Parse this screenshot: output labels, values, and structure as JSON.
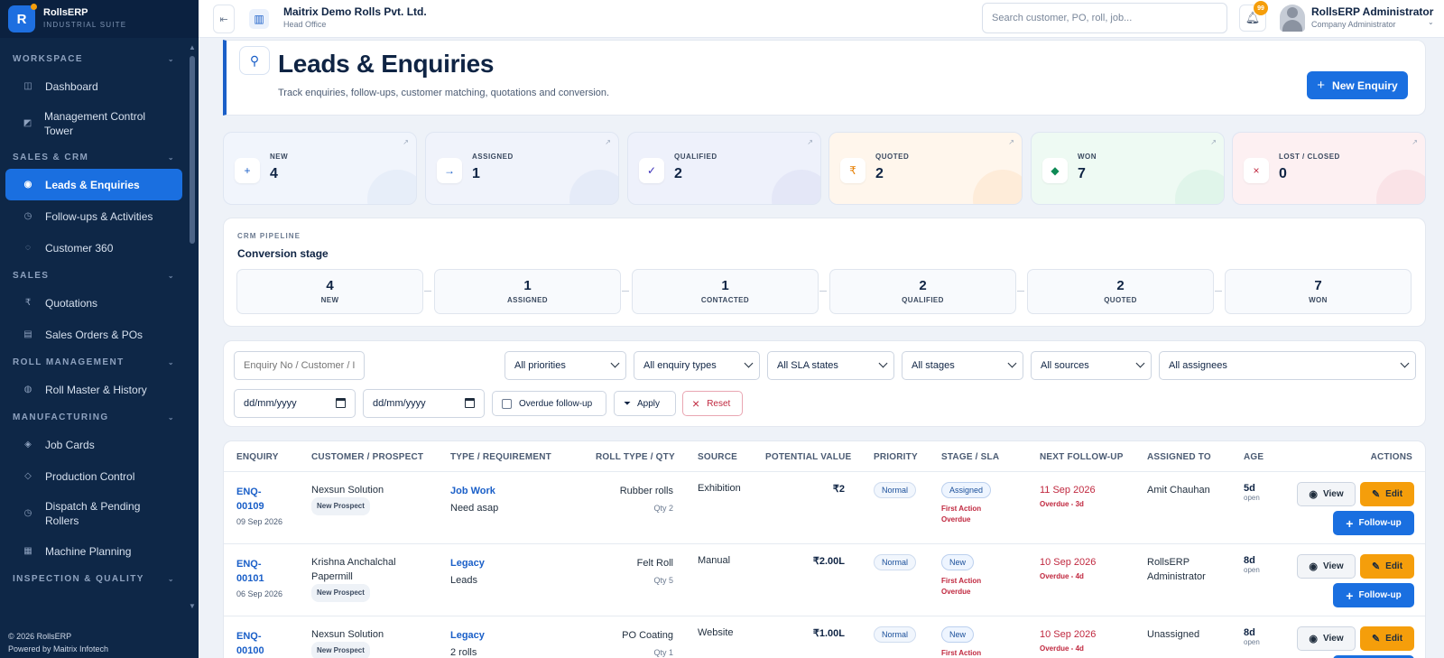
{
  "app": {
    "logo_letter": "R",
    "name": "RollsERP",
    "tagline": "INDUSTRIAL SUITE"
  },
  "colors": {
    "accent": "#1a6fe0",
    "sidebar": "#0e2747",
    "warning": "#f59e0b",
    "danger": "#c0283f"
  },
  "sidebar": {
    "sections": [
      {
        "title": "WORKSPACE",
        "items": [
          {
            "label": "Dashboard",
            "icon": "grid-icon"
          },
          {
            "label": "Management Control Tower",
            "icon": "tower-icon"
          }
        ]
      },
      {
        "title": "SALES & CRM",
        "items": [
          {
            "label": "Leads & Enquiries",
            "icon": "target-icon",
            "active": true
          },
          {
            "label": "Follow-ups & Activities",
            "icon": "clock-icon"
          },
          {
            "label": "Customer 360",
            "icon": "user-circle-icon"
          }
        ]
      },
      {
        "title": "SALES",
        "items": [
          {
            "label": "Quotations",
            "icon": "rupee-icon"
          },
          {
            "label": "Sales Orders & POs",
            "icon": "document-icon"
          }
        ]
      },
      {
        "title": "ROLL MANAGEMENT",
        "items": [
          {
            "label": "Roll Master & History",
            "icon": "roll-icon"
          }
        ]
      },
      {
        "title": "MANUFACTURING",
        "items": [
          {
            "label": "Job Cards",
            "icon": "diamond-icon"
          },
          {
            "label": "Production Control",
            "icon": "gear-icon"
          },
          {
            "label": "Dispatch & Pending Rollers",
            "icon": "truck-icon"
          },
          {
            "label": "Machine Planning",
            "icon": "calendar-icon"
          }
        ]
      },
      {
        "title": "INSPECTION & QUALITY",
        "items": []
      }
    ],
    "footer_copyright": "© 2026 RollsERP",
    "footer_powered": "Powered by Maitrix Infotech"
  },
  "topbar": {
    "company": "Maitrix Demo Rolls Pvt. Ltd.",
    "branch": "Head Office",
    "search_placeholder": "Search customer, PO, roll, job...",
    "notification_count": "99",
    "user_name": "RollsERP Administrator",
    "user_role": "Company Administrator"
  },
  "page": {
    "title": "Leads & Enquiries",
    "subtitle": "Track enquiries, follow-ups, customer matching, quotations and conversion.",
    "new_button": "New Enquiry"
  },
  "stats": [
    {
      "label": "NEW",
      "value": "4",
      "icon": "plus-icon",
      "glyph": "+",
      "color": "#1a5fc8",
      "bg": "#f1f5fc",
      "blob": "#dfe7f6"
    },
    {
      "label": "ASSIGNED",
      "value": "1",
      "icon": "arrow-right-icon",
      "glyph": "→",
      "color": "#1a5fc8",
      "bg": "#f0f3fb",
      "blob": "#dde3f5"
    },
    {
      "label": "QUALIFIED",
      "value": "2",
      "icon": "check-icon",
      "glyph": "✓",
      "color": "#3b2fb8",
      "bg": "#eef1fb",
      "blob": "#dcdff4"
    },
    {
      "label": "QUOTED",
      "value": "2",
      "icon": "rupee-icon",
      "glyph": "₹",
      "color": "#e67e00",
      "bg": "#fff6ec",
      "blob": "#fde4cb"
    },
    {
      "label": "WON",
      "value": "7",
      "icon": "diamond-icon",
      "glyph": "◆",
      "color": "#0e8a55",
      "bg": "#eefaf3",
      "blob": "#d5f0e1"
    },
    {
      "label": "LOST / CLOSED",
      "value": "0",
      "icon": "close-icon",
      "glyph": "×",
      "color": "#c0283f",
      "bg": "#fdf0f2",
      "blob": "#f8d9de"
    }
  ],
  "pipeline": {
    "section": "CRM PIPELINE",
    "title": "Conversion stage",
    "stages": [
      {
        "value": "4",
        "label": "NEW"
      },
      {
        "value": "1",
        "label": "ASSIGNED"
      },
      {
        "value": "1",
        "label": "CONTACTED"
      },
      {
        "value": "2",
        "label": "QUALIFIED"
      },
      {
        "value": "2",
        "label": "QUOTED"
      },
      {
        "value": "7",
        "label": "WON"
      }
    ]
  },
  "filters": {
    "search_placeholder": "Enquiry No / Customer / I",
    "selects": [
      "All priorities",
      "All enquiry types",
      "All SLA states",
      "All stages",
      "All sources",
      "All assignees"
    ],
    "date_placeholder": "dd/mm/yyyy",
    "overdue_label": "Overdue follow-up",
    "apply_label": "Apply",
    "reset_label": "Reset"
  },
  "table": {
    "columns": [
      "ENQUIRY",
      "CUSTOMER / PROSPECT",
      "TYPE / REQUIREMENT",
      "ROLL TYPE / QTY",
      "SOURCE",
      "POTENTIAL VALUE",
      "PRIORITY",
      "STAGE / SLA",
      "NEXT FOLLOW-UP",
      "ASSIGNED TO",
      "AGE",
      "ACTIONS"
    ],
    "view_label": "View",
    "edit_label": "Edit",
    "followup_label": "Follow-up",
    "rows": [
      {
        "enq1": "ENQ-",
        "enq2": "00109",
        "date": "09 Sep 2026",
        "customer1": "Nexsun Solution",
        "customer2": "",
        "tag": "New Prospect",
        "type": "Job Work",
        "req": "Need asap",
        "roll": "Rubber rolls",
        "qty": "Qty 2",
        "source": "Exhibition",
        "value": "₹2",
        "priority": "Normal",
        "stage": "Assigned",
        "sla1": "First Action",
        "sla2": "Overdue",
        "fu_date": "11 Sep 2026",
        "fu_status": "Overdue - 3d",
        "assigned1": "Amit Chauhan",
        "assigned2": "",
        "age": "5d",
        "age_sub": "open"
      },
      {
        "enq1": "ENQ-",
        "enq2": "00101",
        "date": "06 Sep 2026",
        "customer1": "Krishna Anchalchal",
        "customer2": "Papermill",
        "tag": "New Prospect",
        "type": "Legacy",
        "req": "Leads",
        "roll": "Felt Roll",
        "qty": "Qty 5",
        "source": "Manual",
        "value": "₹2.00L",
        "priority": "Normal",
        "stage": "New",
        "sla1": "First Action",
        "sla2": "Overdue",
        "fu_date": "10 Sep 2026",
        "fu_status": "Overdue - 4d",
        "assigned1": "RollsERP",
        "assigned2": "Administrator",
        "age": "8d",
        "age_sub": "open"
      },
      {
        "enq1": "ENQ-",
        "enq2": "00100",
        "date": "",
        "customer1": "Nexsun Solution",
        "customer2": "",
        "tag": "New Prospect",
        "type": "Legacy",
        "req": "2 rolls",
        "roll": "PO Coating",
        "qty": "Qty 1",
        "source": "Website",
        "value": "₹1.00L",
        "priority": "Normal",
        "stage": "New",
        "sla1": "First Action",
        "sla2": "",
        "fu_date": "10 Sep 2026",
        "fu_status": "Overdue - 4d",
        "assigned1": "Unassigned",
        "assigned2": "",
        "age": "8d",
        "age_sub": "open"
      }
    ]
  }
}
